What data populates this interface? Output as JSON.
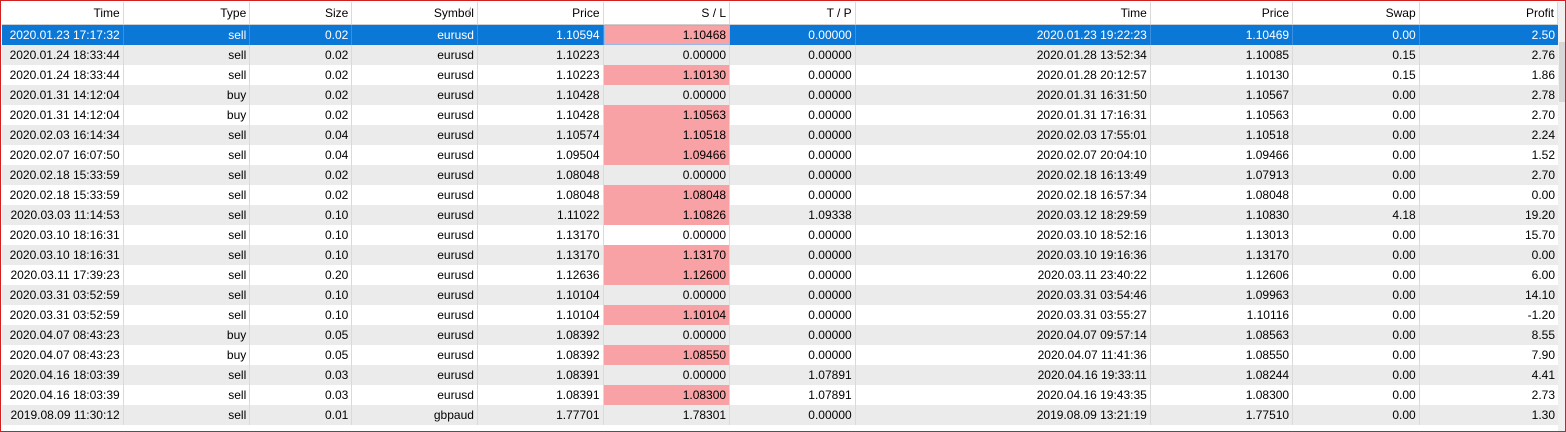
{
  "columns": [
    "Time",
    "Type",
    "Size",
    "Symbol",
    "Price",
    "S / L",
    "T / P",
    "Time",
    "Price",
    "Swap",
    "Profit"
  ],
  "sort_icon": "/",
  "rows": [
    [
      "2020.01.23 17:17:32",
      "sell",
      "0.02",
      "eurusd",
      "1.10594",
      "1.10468",
      "0.00000",
      "2020.01.23 19:22:23",
      "1.10469",
      "0.00",
      "2.50"
    ],
    [
      "2020.01.24 18:33:44",
      "sell",
      "0.02",
      "eurusd",
      "1.10223",
      "0.00000",
      "0.00000",
      "2020.01.28 13:52:34",
      "1.10085",
      "0.15",
      "2.76"
    ],
    [
      "2020.01.24 18:33:44",
      "sell",
      "0.02",
      "eurusd",
      "1.10223",
      "1.10130",
      "0.00000",
      "2020.01.28 20:12:57",
      "1.10130",
      "0.15",
      "1.86"
    ],
    [
      "2020.01.31 14:12:04",
      "buy",
      "0.02",
      "eurusd",
      "1.10428",
      "0.00000",
      "0.00000",
      "2020.01.31 16:31:50",
      "1.10567",
      "0.00",
      "2.78"
    ],
    [
      "2020.01.31 14:12:04",
      "buy",
      "0.02",
      "eurusd",
      "1.10428",
      "1.10563",
      "0.00000",
      "2020.01.31 17:16:31",
      "1.10563",
      "0.00",
      "2.70"
    ],
    [
      "2020.02.03 16:14:34",
      "sell",
      "0.04",
      "eurusd",
      "1.10574",
      "1.10518",
      "0.00000",
      "2020.02.03 17:55:01",
      "1.10518",
      "0.00",
      "2.24"
    ],
    [
      "2020.02.07 16:07:50",
      "sell",
      "0.04",
      "eurusd",
      "1.09504",
      "1.09466",
      "0.00000",
      "2020.02.07 20:04:10",
      "1.09466",
      "0.00",
      "1.52"
    ],
    [
      "2020.02.18 15:33:59",
      "sell",
      "0.02",
      "eurusd",
      "1.08048",
      "0.00000",
      "0.00000",
      "2020.02.18 16:13:49",
      "1.07913",
      "0.00",
      "2.70"
    ],
    [
      "2020.02.18 15:33:59",
      "sell",
      "0.02",
      "eurusd",
      "1.08048",
      "1.08048",
      "0.00000",
      "2020.02.18 16:57:34",
      "1.08048",
      "0.00",
      "0.00"
    ],
    [
      "2020.03.03 11:14:53",
      "sell",
      "0.10",
      "eurusd",
      "1.11022",
      "1.10826",
      "1.09338",
      "2020.03.12 18:29:59",
      "1.10830",
      "4.18",
      "19.20"
    ],
    [
      "2020.03.10 18:16:31",
      "sell",
      "0.10",
      "eurusd",
      "1.13170",
      "0.00000",
      "0.00000",
      "2020.03.10 18:52:16",
      "1.13013",
      "0.00",
      "15.70"
    ],
    [
      "2020.03.10 18:16:31",
      "sell",
      "0.10",
      "eurusd",
      "1.13170",
      "1.13170",
      "0.00000",
      "2020.03.10 19:16:36",
      "1.13170",
      "0.00",
      "0.00"
    ],
    [
      "2020.03.11 17:39:23",
      "sell",
      "0.20",
      "eurusd",
      "1.12636",
      "1.12600",
      "0.00000",
      "2020.03.11 23:40:22",
      "1.12606",
      "0.00",
      "6.00"
    ],
    [
      "2020.03.31 03:52:59",
      "sell",
      "0.10",
      "eurusd",
      "1.10104",
      "0.00000",
      "0.00000",
      "2020.03.31 03:54:46",
      "1.09963",
      "0.00",
      "14.10"
    ],
    [
      "2020.03.31 03:52:59",
      "sell",
      "0.10",
      "eurusd",
      "1.10104",
      "1.10104",
      "0.00000",
      "2020.03.31 03:55:27",
      "1.10116",
      "0.00",
      "-1.20"
    ],
    [
      "2020.04.07 08:43:23",
      "buy",
      "0.05",
      "eurusd",
      "1.08392",
      "0.00000",
      "0.00000",
      "2020.04.07 09:57:14",
      "1.08563",
      "0.00",
      "8.55"
    ],
    [
      "2020.04.07 08:43:23",
      "buy",
      "0.05",
      "eurusd",
      "1.08392",
      "1.08550",
      "0.00000",
      "2020.04.07 11:41:36",
      "1.08550",
      "0.00",
      "7.90"
    ],
    [
      "2020.04.16 18:03:39",
      "sell",
      "0.03",
      "eurusd",
      "1.08391",
      "0.00000",
      "1.07891",
      "2020.04.16 19:33:11",
      "1.08244",
      "0.00",
      "4.41"
    ],
    [
      "2020.04.16 18:03:39",
      "sell",
      "0.03",
      "eurusd",
      "1.08391",
      "1.08300",
      "1.07891",
      "2020.04.16 19:43:35",
      "1.08300",
      "0.00",
      "2.73"
    ],
    [
      "2019.08.09 11:30:12",
      "sell",
      "0.01",
      "gbpaud",
      "1.77701",
      "1.78301",
      "0.00000",
      "2019.08.09 13:21:19",
      "1.77510",
      "0.00",
      "1.30"
    ]
  ],
  "selected_row": 0,
  "sl_hit_rows": [
    0,
    2,
    4,
    5,
    6,
    8,
    9,
    11,
    12,
    14,
    16,
    18
  ],
  "colors": {
    "selected": "#0b78d7",
    "sl_hit": "#f8a2a6",
    "alt_row": "#ebebeb"
  }
}
